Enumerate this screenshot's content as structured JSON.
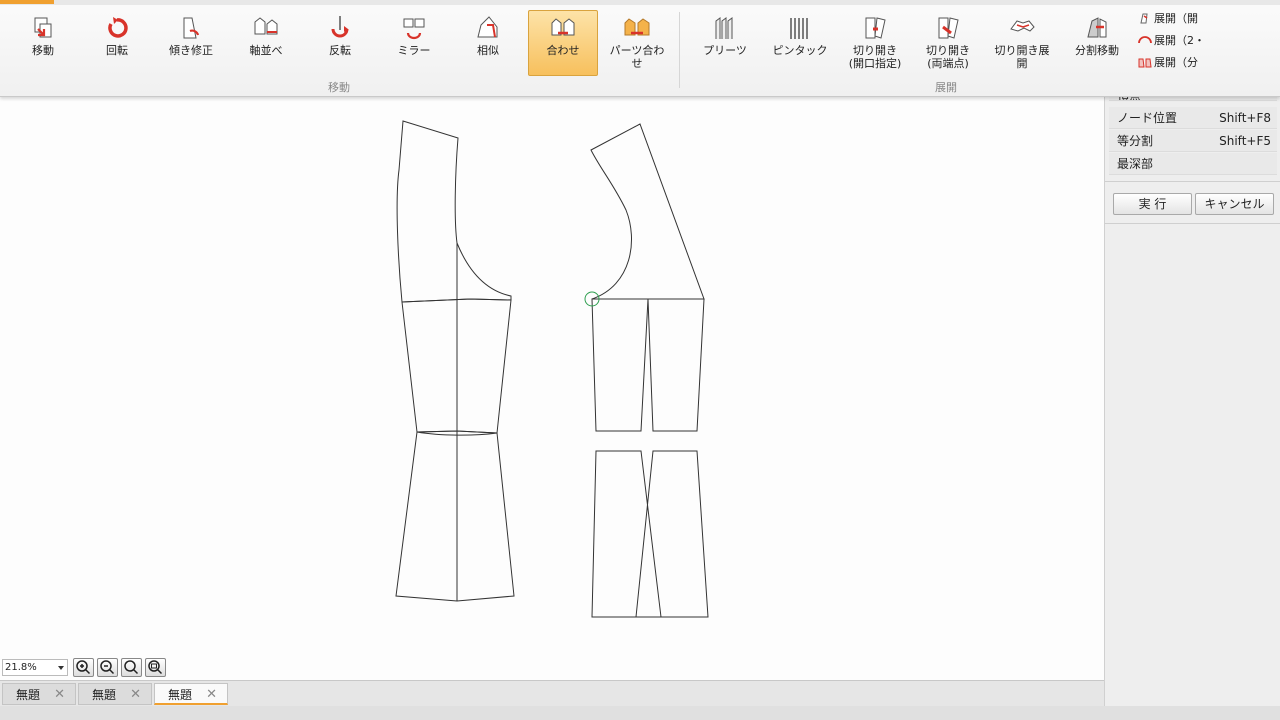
{
  "ribbon": {
    "buttons": [
      {
        "label": "移動",
        "icon": "move-icon"
      },
      {
        "label": "回転",
        "icon": "rotate-icon"
      },
      {
        "label": "傾き修正",
        "icon": "tilt-correct-icon"
      },
      {
        "label": "軸並べ",
        "icon": "axis-align-icon"
      },
      {
        "label": "反転",
        "icon": "flip-icon"
      },
      {
        "label": "ミラー",
        "icon": "mirror-icon"
      },
      {
        "label": "相似",
        "icon": "similar-icon"
      },
      {
        "label": "合わせ",
        "icon": "match-icon"
      },
      {
        "label": "パーツ合わせ",
        "icon": "parts-match-icon"
      },
      {
        "label": "プリーツ",
        "icon": "pleat-icon"
      },
      {
        "label": "ピンタック",
        "icon": "pintuck-icon"
      },
      {
        "label": "切り開き\n(開口指定)",
        "icon": "slash-open-icon"
      },
      {
        "label": "切り開き\n(両端点)",
        "icon": "slash-both-icon"
      },
      {
        "label": "切り開き展開",
        "icon": "slash-spread-icon"
      },
      {
        "label": "分割移動",
        "icon": "split-move-icon"
      }
    ],
    "small_items": [
      {
        "label": "展開（開",
        "icon": "spread-open-icon"
      },
      {
        "label": "展開（2・",
        "icon": "spread-two-icon"
      },
      {
        "label": "展開（分",
        "icon": "spread-split-icon"
      }
    ],
    "groups": {
      "move": "移動",
      "spread": "展開"
    },
    "active_label": "合わせ"
  },
  "panel": {
    "truncated": "頂点",
    "rows": [
      {
        "label": "ノード位置",
        "shortcut": "Shift+F8"
      },
      {
        "label": "等分割",
        "shortcut": "Shift+F5"
      },
      {
        "label": "最深部",
        "shortcut": ""
      }
    ],
    "execute": "実 行",
    "cancel": "キャンセル"
  },
  "zoom": {
    "value": "21.8%"
  },
  "tabs": [
    {
      "label": "無題",
      "active": false
    },
    {
      "label": "無題",
      "active": false
    },
    {
      "label": "無題",
      "active": true
    }
  ],
  "colors": {
    "accent": "#f0a030",
    "icon_red": "#d8332a",
    "marker": "#2e9e4f"
  }
}
